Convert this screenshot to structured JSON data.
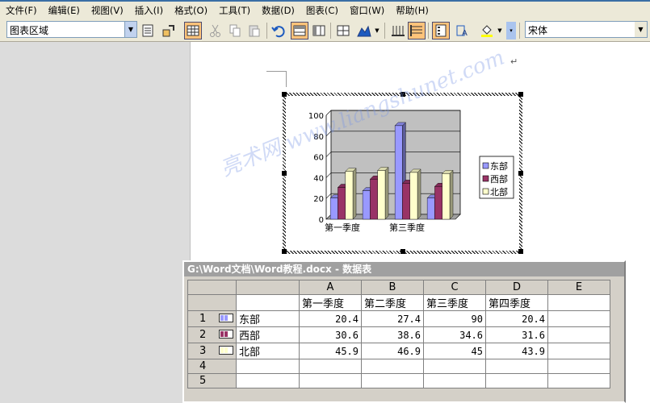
{
  "menubar": {
    "items": [
      "文件(F)",
      "编辑(E)",
      "视图(V)",
      "插入(I)",
      "格式(O)",
      "工具(T)",
      "数据(D)",
      "图表(C)",
      "窗口(W)",
      "帮助(H)"
    ]
  },
  "toolbar": {
    "chart_object_combo": "图表区域",
    "font_combo": "宋体"
  },
  "document": {
    "paragraph_mark": "↵"
  },
  "datasheet": {
    "title": "G:\\Word文档\\Word教程.docx - 数据表",
    "column_letters": [
      "A",
      "B",
      "C",
      "D",
      "E"
    ],
    "column_headers": [
      "第一季度",
      "第二季度",
      "第三季度",
      "第四季度",
      ""
    ],
    "rows": [
      {
        "num": "1",
        "label": "东部",
        "values": [
          "20.4",
          "27.4",
          "90",
          "20.4"
        ]
      },
      {
        "num": "2",
        "label": "西部",
        "values": [
          "30.6",
          "38.6",
          "34.6",
          "31.6"
        ]
      },
      {
        "num": "3",
        "label": "北部",
        "values": [
          "45.9",
          "46.9",
          "45",
          "43.9"
        ]
      },
      {
        "num": "4",
        "label": "",
        "values": [
          "",
          "",
          "",
          ""
        ]
      },
      {
        "num": "5",
        "label": "",
        "values": [
          "",
          "",
          "",
          ""
        ]
      }
    ]
  },
  "chart_data": {
    "type": "bar",
    "categories": [
      "第一季度",
      "第二季度",
      "第三季度",
      "第四季度"
    ],
    "visible_category_labels": [
      "第一季度",
      "第三季度"
    ],
    "series": [
      {
        "name": "东部",
        "values": [
          20.4,
          27.4,
          90,
          20.4
        ],
        "color": "#9999ff"
      },
      {
        "name": "西部",
        "values": [
          30.6,
          38.6,
          34.6,
          31.6
        ],
        "color": "#993366"
      },
      {
        "name": "北部",
        "values": [
          45.9,
          46.9,
          45,
          43.9
        ],
        "color": "#ffffcc"
      }
    ],
    "yticks": [
      "0",
      "20",
      "40",
      "60",
      "80",
      "100"
    ],
    "ylim": [
      0,
      100
    ],
    "grid": true,
    "legend": "right",
    "plot_background": "#c0c0c0"
  },
  "watermark": "亮术网 www.liangshunet.com"
}
